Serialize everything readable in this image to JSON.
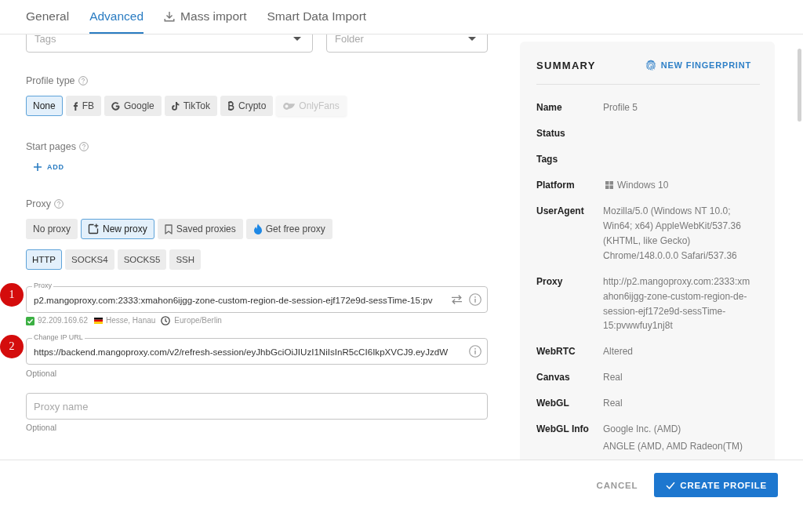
{
  "tabs": [
    {
      "label": "General",
      "selected": false,
      "kind": "text"
    },
    {
      "label": "Advanced",
      "selected": true,
      "kind": "text"
    },
    {
      "label": "Mass import",
      "selected": false,
      "kind": "download"
    },
    {
      "label": "Smart Data Import",
      "selected": false,
      "kind": "text"
    }
  ],
  "form": {
    "tags": {
      "placeholder": "Tags"
    },
    "folder": {
      "placeholder": "Folder"
    },
    "profile_type": {
      "label": "Profile type",
      "options": [
        {
          "label": "None",
          "kind": "text",
          "selected": true,
          "disabled": false
        },
        {
          "label": "FB",
          "kind": "fb",
          "selected": false,
          "disabled": false
        },
        {
          "label": "Google",
          "kind": "google",
          "selected": false,
          "disabled": false
        },
        {
          "label": "TikTok",
          "kind": "tiktok",
          "selected": false,
          "disabled": false
        },
        {
          "label": "Crypto",
          "kind": "crypto",
          "selected": false,
          "disabled": false
        },
        {
          "label": "OnlyFans",
          "kind": "onlyfans",
          "selected": false,
          "disabled": true
        }
      ]
    },
    "start_pages": {
      "label": "Start pages",
      "add": "ADD"
    },
    "proxy": {
      "label": "Proxy",
      "modes": [
        {
          "label": "No proxy",
          "kind": "text",
          "selected": false
        },
        {
          "label": "New proxy",
          "kind": "new",
          "selected": true
        },
        {
          "label": "Saved proxies",
          "kind": "saved",
          "selected": false
        },
        {
          "label": "Get free proxy",
          "kind": "free",
          "selected": false
        }
      ],
      "protocols": [
        {
          "label": "HTTP",
          "selected": true
        },
        {
          "label": "SOCKS4",
          "selected": false
        },
        {
          "label": "SOCKS5",
          "selected": false
        },
        {
          "label": "SSH",
          "selected": false
        }
      ],
      "proxy_field": {
        "marker": "1",
        "label": "Proxy",
        "value": "p2.mangoproxy.com:2333:xmahon6ijgg-zone-custom-region-de-session-ejf172e9d-sessTime-15:pv"
      },
      "check": {
        "valid": true,
        "ip": "92.209.169.62",
        "location": "Hesse, Hanau",
        "timezone": "Europe/Berlin"
      },
      "change_ip_field": {
        "marker": "2",
        "label": "Change IP URL",
        "value": "https://backend.mangoproxy.com/v2/refresh-session/eyJhbGciOiJIUzI1NiIsInR5cCI6IkpXVCJ9.eyJzdW",
        "helper": "Optional"
      },
      "name_field": {
        "placeholder": "Proxy name",
        "helper": "Optional"
      }
    }
  },
  "summary": {
    "title": "SUMMARY",
    "action": "NEW FINGERPRINT",
    "rows": [
      {
        "label": "Name",
        "kind": "text",
        "values": [
          "Profile 5"
        ]
      },
      {
        "label": "Status",
        "kind": "text"
      },
      {
        "label": "Tags",
        "kind": "text"
      },
      {
        "label": "Platform",
        "kind": "platform",
        "values": [
          "Windows 10"
        ]
      },
      {
        "label": "UserAgent",
        "kind": "text",
        "values": [
          "Mozilla/5.0 (Windows NT 10.0; Win64; x64) AppleWebKit/537.36 (KHTML, like Gecko) Chrome/148.0.0.0 Safari/537.36"
        ]
      },
      {
        "label": "Proxy",
        "kind": "text",
        "values": [
          "http://p2.mangoproxy.com:2333:xmahon6ijgg-zone-custom-region-de-session-ejf172e9d-sessTime-15:pvwwfuy1nj8t"
        ]
      },
      {
        "label": "WebRTC",
        "kind": "text",
        "values": [
          "Altered"
        ]
      },
      {
        "label": "Canvas",
        "kind": "text",
        "values": [
          "Real"
        ]
      },
      {
        "label": "WebGL",
        "kind": "text",
        "values": [
          "Real"
        ]
      },
      {
        "label": "WebGL Info",
        "kind": "text",
        "values": [
          "Google Inc. (AMD)",
          "ANGLE (AMD, AMD Radeon(TM)"
        ]
      }
    ]
  },
  "footer": {
    "cancel": "CANCEL",
    "submit": "CREATE PROFILE"
  }
}
